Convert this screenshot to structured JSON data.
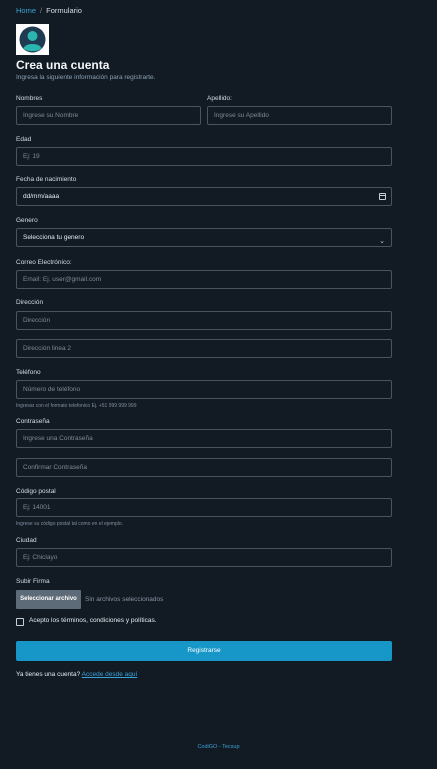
{
  "breadcrumb": {
    "home": "Home",
    "separator": "/",
    "current": "Formulario"
  },
  "header": {
    "title": "Crea una cuenta",
    "subtitle": "Ingresa la siguiente información para registrarte."
  },
  "fields": {
    "nombres": {
      "label": "Nombres",
      "placeholder": "Ingrese su Nombre"
    },
    "apellido": {
      "label": "Apellido:",
      "placeholder": "Ingrese su Apellido"
    },
    "edad": {
      "label": "Edad",
      "placeholder": "Ej: 19"
    },
    "nacimiento": {
      "label": "Fecha de nacimiento",
      "value": "dd/mm/aaaa"
    },
    "genero": {
      "label": "Genero",
      "value": "Selecciona tu genero"
    },
    "correo": {
      "label": "Correo Electrónico:",
      "placeholder": "Email: Ej. user@gmail.com"
    },
    "direccion": {
      "label": "Dirección",
      "placeholder": "Dirección",
      "placeholder2": "Dirección linea 2"
    },
    "telefono": {
      "label": "Teléfono",
      "placeholder": "Número de teléfono",
      "hint": "Ingresar con el formato telefonico Ej. +51 999 999 999"
    },
    "contrasena": {
      "label": "Contraseña",
      "placeholder": "Ingrese una Contraseña",
      "placeholder2": "Confirmar Contraseña"
    },
    "postal": {
      "label": "Código postal",
      "placeholder": "Ej: 14001",
      "hint": "Ingrese su código postal tal como en el ejemplo."
    },
    "ciudad": {
      "label": "Ciudad",
      "placeholder": "Ej: Chiclayo"
    },
    "firma": {
      "label": "Subir Firma",
      "button": "Seleccionar archivo",
      "status": "Sin archivos seleccionados"
    }
  },
  "terms": {
    "label": "Acepto los términos, condiciones y políticas."
  },
  "submit": {
    "label": "Registrarse"
  },
  "login": {
    "text": "Ya tienes una cuenta?",
    "link": "Accede desde aquí"
  },
  "footer": {
    "text": "CodiGO - Tecsup"
  },
  "colors": {
    "background": "#121a23",
    "accent": "#1797c7",
    "link": "#3aa3d9",
    "border": "#4a545f"
  }
}
